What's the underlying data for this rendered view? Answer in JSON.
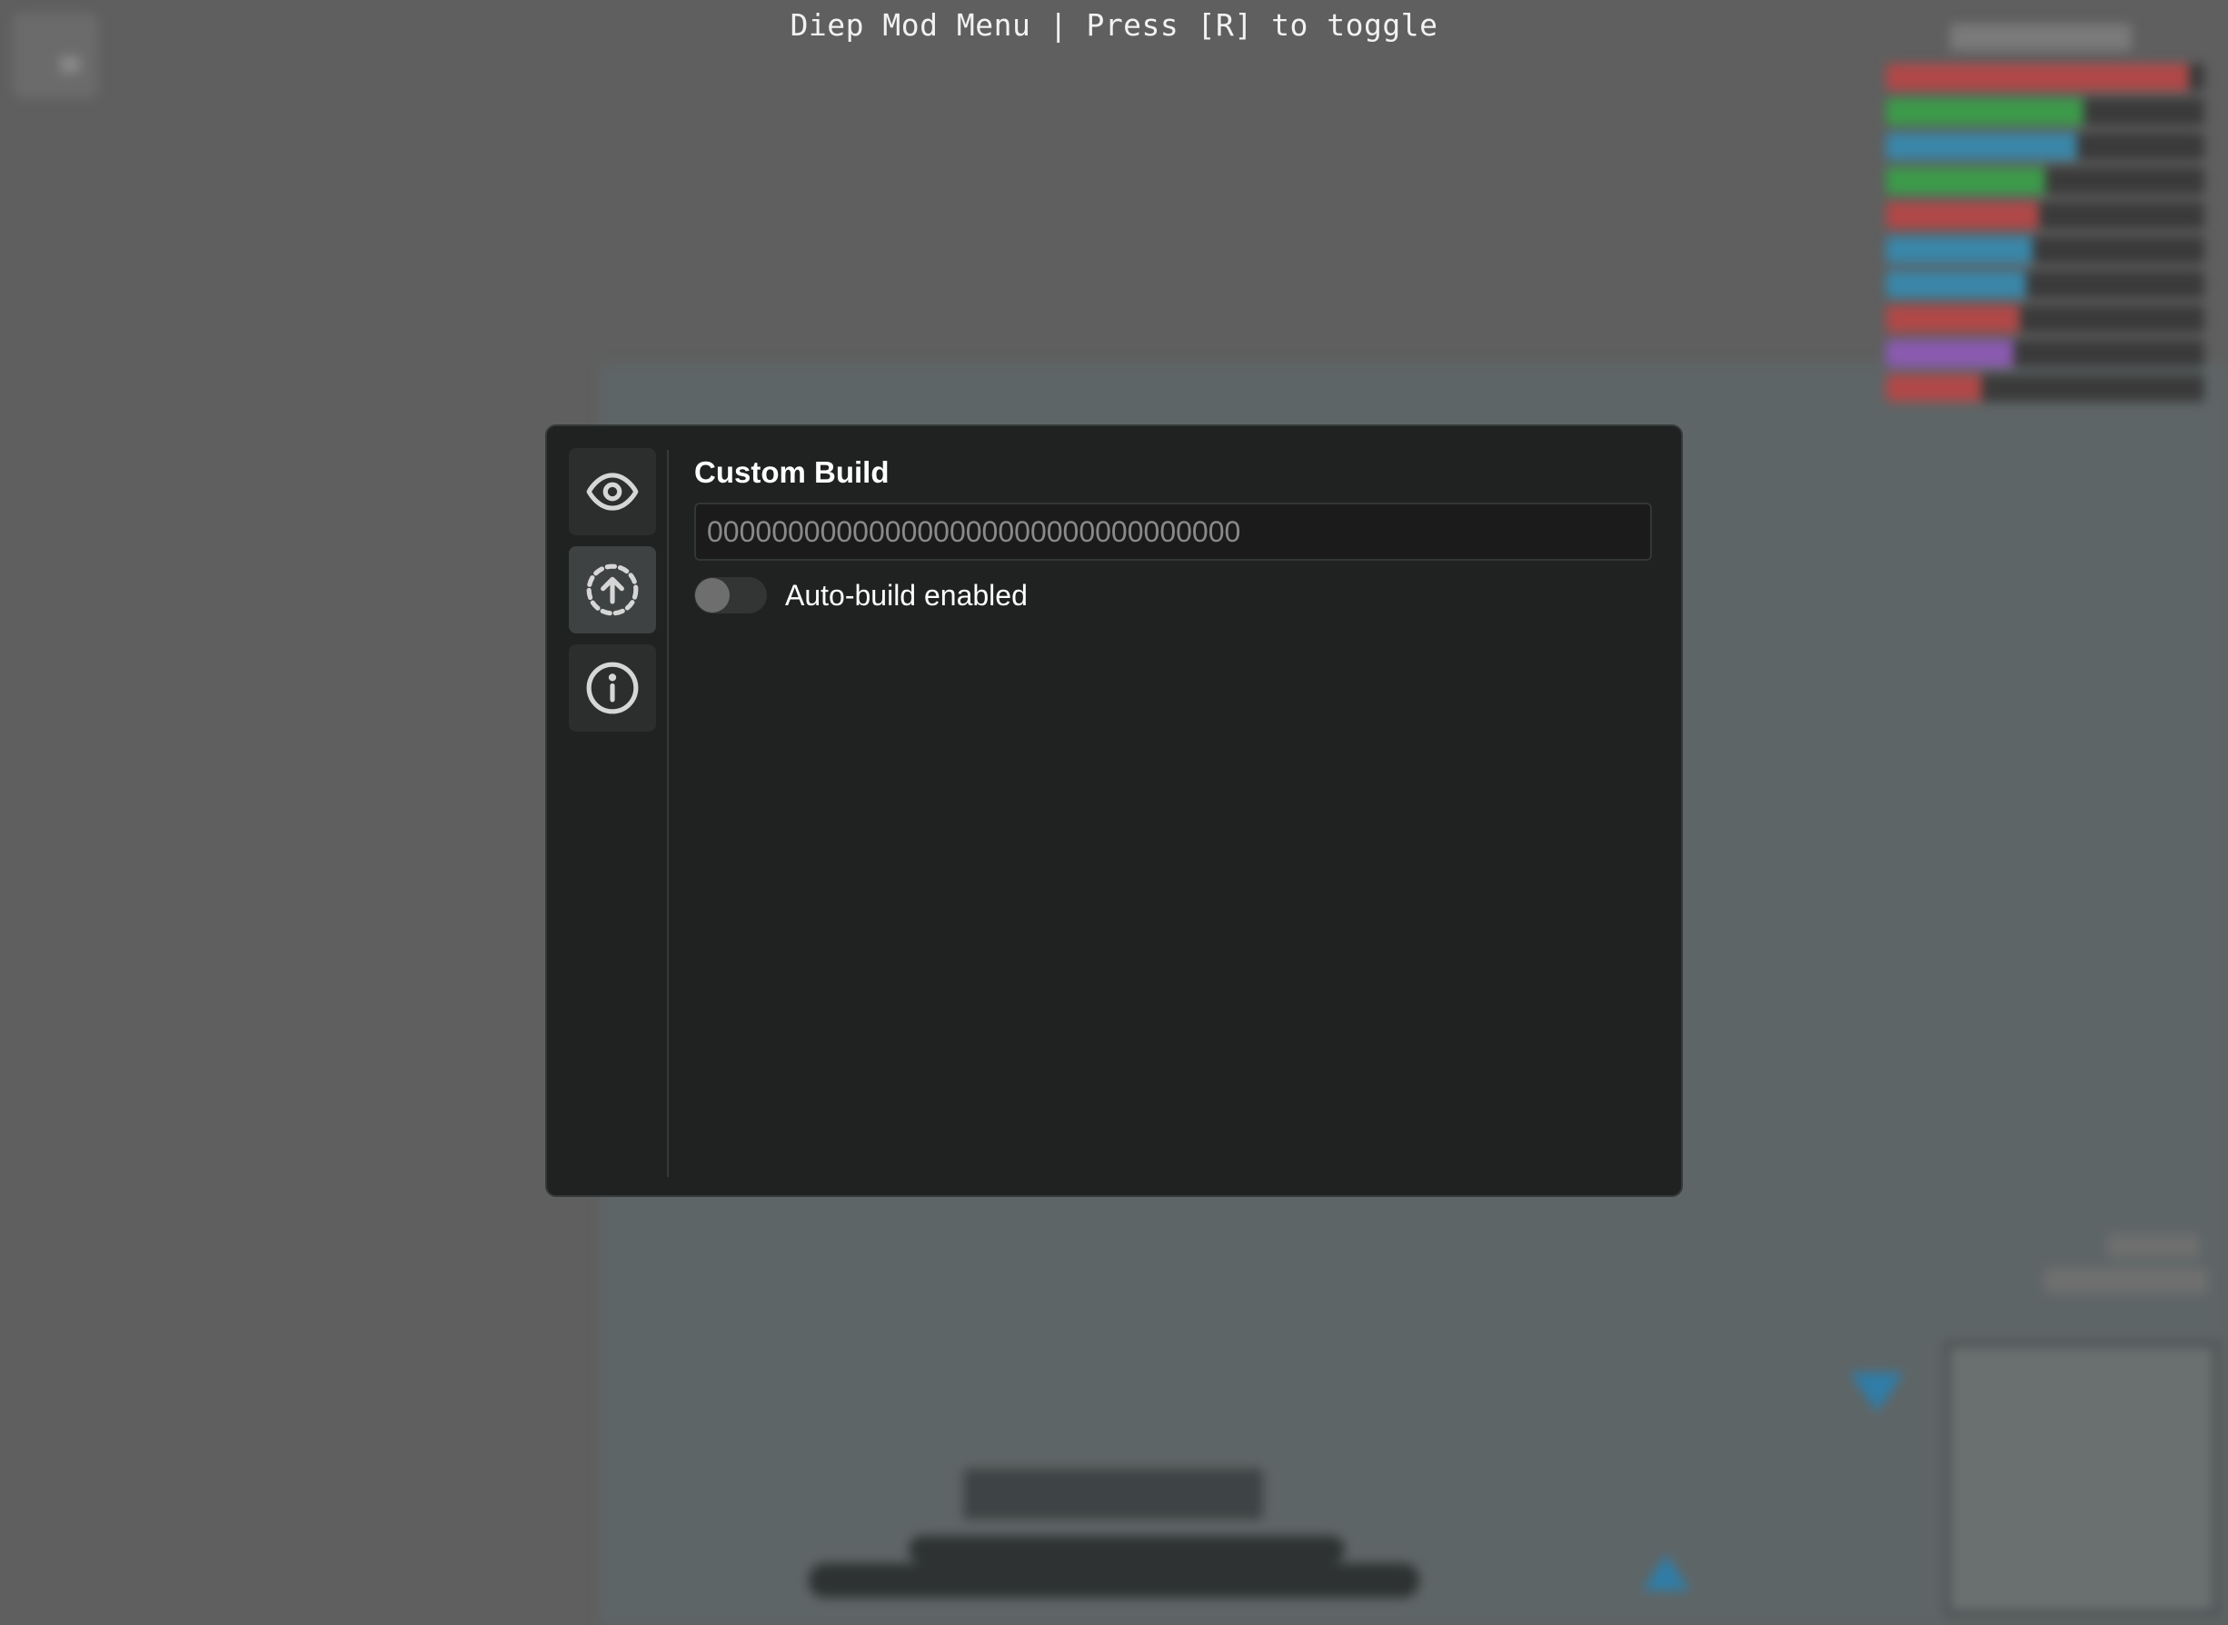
{
  "banner": {
    "text": "Diep Mod Menu | Press [R] to toggle"
  },
  "sidebar": {
    "items": [
      {
        "name": "visuals",
        "icon": "eye-icon",
        "active": false
      },
      {
        "name": "build",
        "icon": "upload-circle-icon",
        "active": true
      },
      {
        "name": "info",
        "icon": "info-icon",
        "active": false
      }
    ]
  },
  "main": {
    "section_title": "Custom Build",
    "build_input": {
      "value": "",
      "placeholder": "000000000000000000000000000000000"
    },
    "auto_build": {
      "label": "Auto-build enabled",
      "enabled": false
    }
  },
  "colors": {
    "modal_bg": "#202222",
    "active_tab_bg": "#3f4242",
    "text": "#ffffff",
    "placeholder": "#8a8a8a"
  }
}
